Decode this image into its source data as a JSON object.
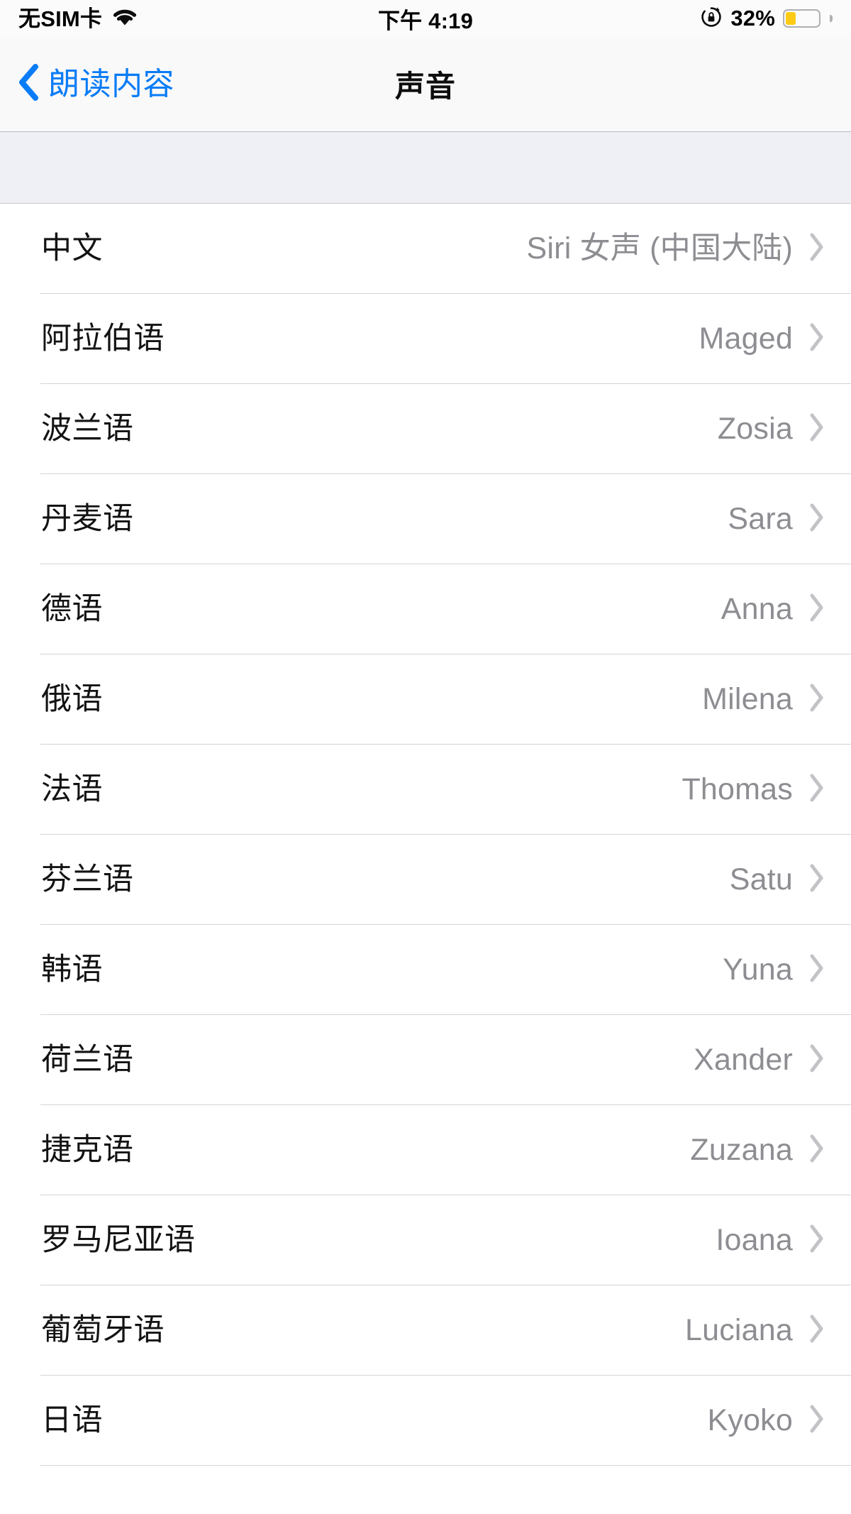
{
  "status_bar": {
    "carrier": "无SIM卡",
    "wifi_icon": "wifi-icon",
    "time": "下午 4:19",
    "orientation_lock_icon": "rotation-lock-icon",
    "battery_percent": "32%",
    "battery_level": 32,
    "battery_color": "#fdcb16"
  },
  "nav_bar": {
    "back_icon": "chevron-left-icon",
    "back_label": "朗读内容",
    "title": "声音",
    "accent_color": "#0a7cf6"
  },
  "list": {
    "disclosure_icon": "chevron-right-icon",
    "rows": [
      {
        "language": "中文",
        "voice": "Siri 女声 (中国大陆)"
      },
      {
        "language": "阿拉伯语",
        "voice": "Maged"
      },
      {
        "language": "波兰语",
        "voice": "Zosia"
      },
      {
        "language": "丹麦语",
        "voice": "Sara"
      },
      {
        "language": "德语",
        "voice": "Anna"
      },
      {
        "language": "俄语",
        "voice": "Milena"
      },
      {
        "language": "法语",
        "voice": "Thomas"
      },
      {
        "language": "芬兰语",
        "voice": "Satu"
      },
      {
        "language": "韩语",
        "voice": "Yuna"
      },
      {
        "language": "荷兰语",
        "voice": "Xander"
      },
      {
        "language": "捷克语",
        "voice": "Zuzana"
      },
      {
        "language": "罗马尼亚语",
        "voice": "Ioana"
      },
      {
        "language": "葡萄牙语",
        "voice": "Luciana"
      },
      {
        "language": "日语",
        "voice": "Kyoko"
      }
    ]
  }
}
